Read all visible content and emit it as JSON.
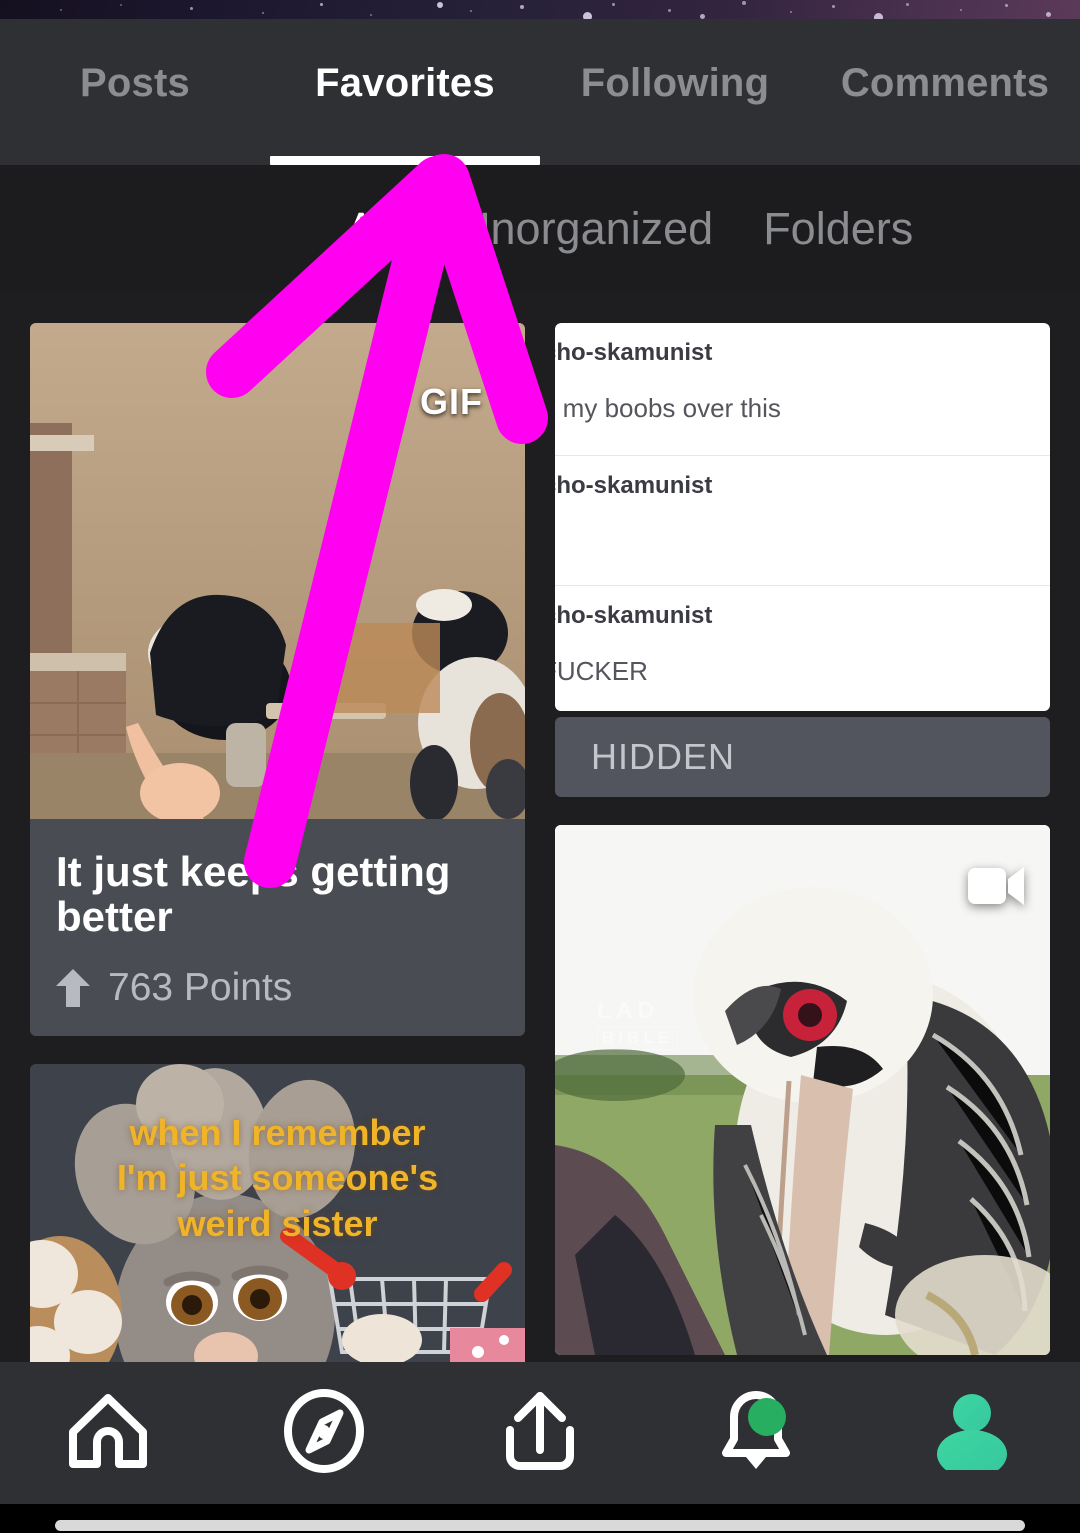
{
  "app": {
    "background_color": "#1e1e20",
    "topbar_color": "#2e3034",
    "accent_magenta": "#ff00f0",
    "accent_green": "#27ae60",
    "avatar_teal": "#3ecfa5"
  },
  "tabs": {
    "items": [
      {
        "label": "Posts",
        "active": false
      },
      {
        "label": "Favorites",
        "active": true
      },
      {
        "label": "Following",
        "active": false
      },
      {
        "label": "Comments",
        "active": false
      }
    ]
  },
  "subtabs": {
    "items": [
      {
        "label": "All",
        "active": true
      },
      {
        "label": "Unorganized",
        "active": false
      },
      {
        "label": "Folders",
        "active": false
      }
    ]
  },
  "feed": {
    "left_column": [
      {
        "type": "gif",
        "badge": "GIF",
        "title": "It just keeps getting better",
        "points_value": "763",
        "points_label": "Points",
        "points_display": "763 Points"
      },
      {
        "type": "image",
        "caption_lines": [
          "when I remember",
          "I'm just someone's",
          "weird sister"
        ],
        "caption_color": "#f0b429"
      }
    ],
    "right_column": [
      {
        "type": "text_post_screenshot",
        "posts": [
          {
            "user": "cho-skamunist",
            "body": "n my boobs over this"
          },
          {
            "user": "cho-skamunist",
            "body": ""
          },
          {
            "user": "cho-skamunist",
            "body": "FUCKER"
          }
        ],
        "hidden_label": "HIDDEN"
      },
      {
        "type": "video",
        "badge_icon": "video-camera-icon",
        "watermark_line1": "LAD",
        "watermark_line2": "BIBLE"
      }
    ]
  },
  "bottom_nav": {
    "items": [
      {
        "name": "home",
        "icon": "home-icon",
        "active": false,
        "badge": false
      },
      {
        "name": "explore",
        "icon": "compass-icon",
        "active": false,
        "badge": false
      },
      {
        "name": "upload",
        "icon": "upload-icon",
        "active": false,
        "badge": false
      },
      {
        "name": "notifications",
        "icon": "bell-icon",
        "active": false,
        "badge": true
      },
      {
        "name": "profile",
        "icon": "person-icon",
        "active": true,
        "badge": false
      }
    ]
  },
  "annotation": {
    "shape": "arrow-up",
    "color": "#ff00f0",
    "points_to": "Favorites tab"
  }
}
